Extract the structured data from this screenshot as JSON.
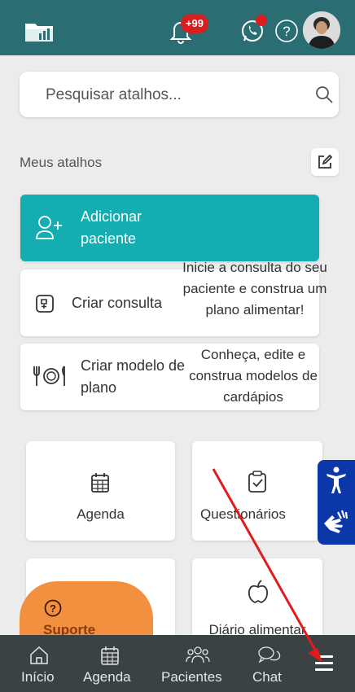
{
  "header": {
    "logo_icon": "folder-chart-icon",
    "notifications_badge": "+99",
    "icons": [
      "bell-icon",
      "whatsapp-icon",
      "help-icon"
    ],
    "avatar": "user-avatar"
  },
  "search": {
    "placeholder": "Pesquisar atalhos...",
    "icon": "search-icon"
  },
  "shortcuts": {
    "title": "Meus atalhos",
    "edit_icon": "edit-icon",
    "items": [
      {
        "label": "Adicionar paciente",
        "icon": "add-user-icon"
      },
      {
        "label": "Criar consulta",
        "icon": "add-document-icon"
      },
      {
        "label": "Criar modelo de plano",
        "icon": "cutlery-plate-icon"
      }
    ],
    "tooltips": [
      "Inicie a consulta do seu paciente e construa um plano alimentar!",
      "Conheça, edite e construa modelos de cardápios"
    ]
  },
  "tiles": [
    {
      "label": "Agenda",
      "icon": "calendar-icon"
    },
    {
      "label": "Questionários",
      "icon": "clipboard-check-icon"
    },
    {
      "label": "Diário alimentar",
      "icon": "apple-icon"
    }
  ],
  "support": {
    "label": "Suporte",
    "icon": "help-circle-icon"
  },
  "accessibility": {
    "icons": [
      "accessibility-person-icon",
      "sign-language-icon"
    ]
  },
  "bottom_nav": {
    "items": [
      {
        "label": "Início",
        "icon": "home-icon"
      },
      {
        "label": "Agenda",
        "icon": "calendar-icon"
      },
      {
        "label": "Pacientes",
        "icon": "users-icon"
      },
      {
        "label": "Chat",
        "icon": "chat-icon"
      }
    ],
    "menu_icon": "menu-icon"
  },
  "colors": {
    "header": "#2a6d73",
    "accent": "#14adb1",
    "support": "#f3903f",
    "nav": "#3b4244",
    "badge": "#d71f1f",
    "accessibility": "#0c37a8",
    "annotation_arrow": "#e01b1b"
  }
}
